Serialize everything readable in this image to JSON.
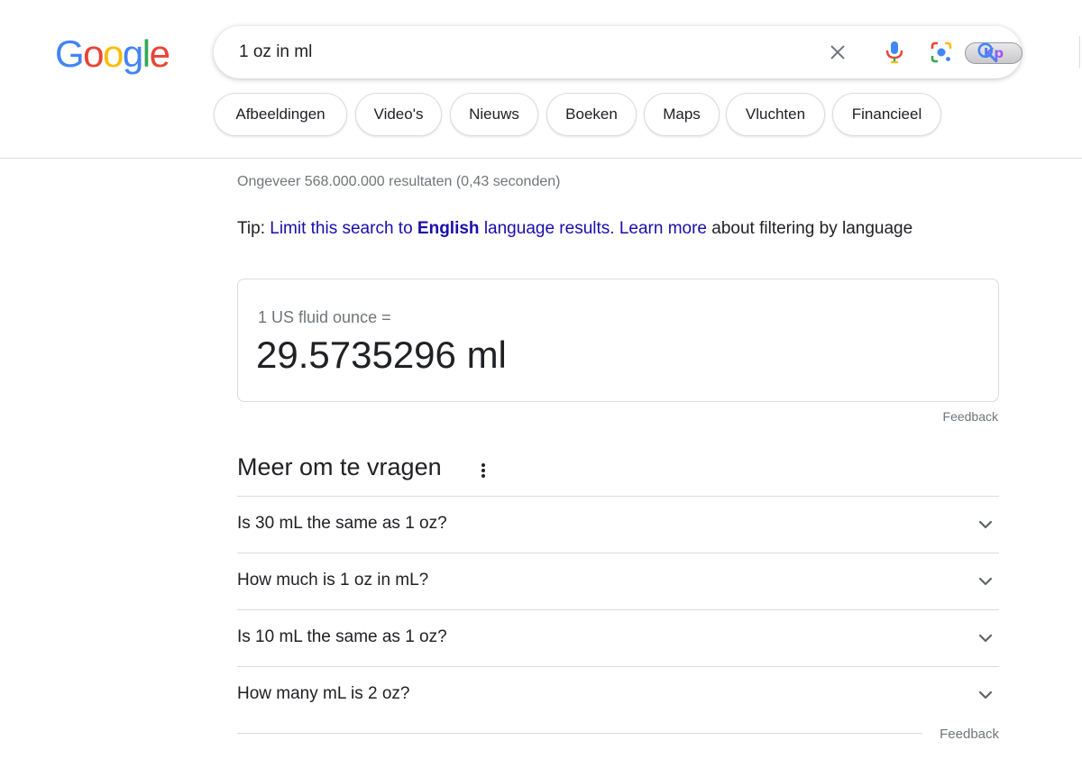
{
  "logo": {
    "letters": [
      "G",
      "o",
      "o",
      "g",
      "l",
      "e"
    ],
    "colors": [
      "#4285F4",
      "#EA4335",
      "#FBBC05",
      "#4285F4",
      "#34A853",
      "#EA4335"
    ]
  },
  "search": {
    "query": "1 oz in ml",
    "kp_badge": "Kp",
    "icons": [
      "close-icon",
      "mic-icon",
      "lens-icon",
      "search-icon"
    ]
  },
  "chips": [
    "Afbeeldingen",
    "Video's",
    "Nieuws",
    "Boeken",
    "Maps",
    "Vluchten",
    "Financieel"
  ],
  "stats": "Ongeveer 568.000.000 resultaten (0,43 seconden)",
  "tip": {
    "prefix": "Tip: ",
    "link_part1": "Limit this search to ",
    "link_bold": "English",
    "link_part2": " language results.",
    "learn_more": "Learn more",
    "suffix": " about filtering by language"
  },
  "answer": {
    "sub": "1 US fluid ounce =",
    "main": "29.5735296 ml",
    "feedback": "Feedback"
  },
  "paa": {
    "title": "Meer om te vragen",
    "questions": [
      "Is 30 mL the same as 1 oz?",
      "How much is 1 oz in mL?",
      "Is 10 mL the same as 1 oz?",
      "How many mL is 2 oz?"
    ],
    "feedback": "Feedback"
  },
  "colors": {
    "link": "#1a0dab",
    "muted": "#70757a",
    "border": "#dadce0"
  }
}
